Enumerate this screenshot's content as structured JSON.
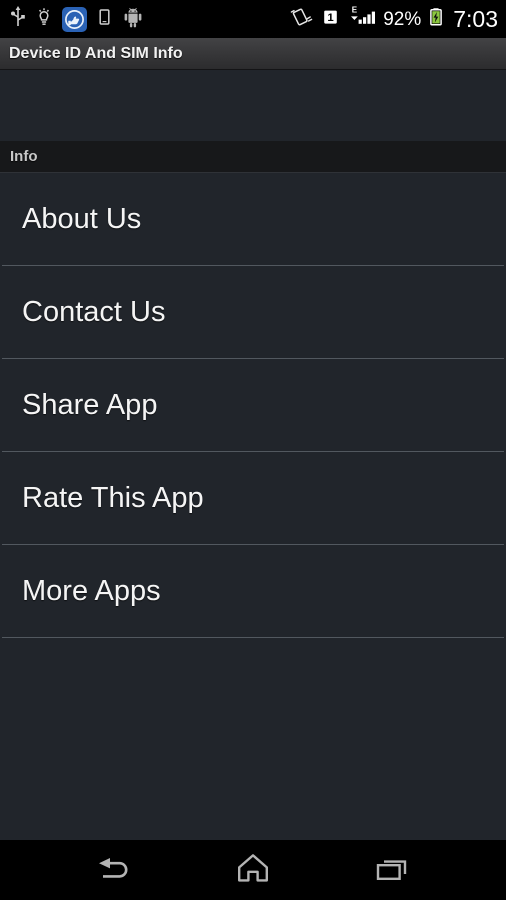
{
  "status_bar": {
    "left_icons": [
      {
        "name": "usb-icon",
        "label": "USB connected"
      },
      {
        "name": "lightbulb-icon",
        "label": "Notification"
      },
      {
        "name": "cleaner-app-icon",
        "label": "Cleaner"
      },
      {
        "name": "device-icon",
        "label": "Device"
      },
      {
        "name": "android-robot-icon",
        "label": "Android system"
      }
    ],
    "right": {
      "rotation_icon": "screen-rotation-icon",
      "sim_indicator": "1",
      "network_type": "E",
      "signal_icon": "signal-bars-icon",
      "battery_percent": "92%",
      "battery_icon": "battery-charging-icon",
      "clock": "7:03"
    },
    "colors": {
      "background": "#000000",
      "text": "#ffffff",
      "battery_green": "#8cc63f",
      "cleaner_blue": "#2a62b5",
      "icon_gray": "#c0c0c0"
    }
  },
  "title_bar": {
    "title": "Device ID And SIM Info"
  },
  "section": {
    "header": "Info"
  },
  "list": {
    "items": [
      {
        "label": "About Us",
        "name": "list-item-about-us"
      },
      {
        "label": "Contact Us",
        "name": "list-item-contact-us"
      },
      {
        "label": "Share App",
        "name": "list-item-share-app"
      },
      {
        "label": "Rate This App",
        "name": "list-item-rate-this-app"
      },
      {
        "label": "More Apps",
        "name": "list-item-more-apps"
      }
    ]
  },
  "nav_bar": {
    "back": "Back",
    "home": "Home",
    "recents": "Recent apps"
  },
  "colors": {
    "content_background": "#21252b",
    "section_header_background": "#17181a",
    "divider": "#52585f",
    "list_text": "#f5f5f5",
    "nav_background": "#000000",
    "nav_icon": "#b4b4b4"
  }
}
